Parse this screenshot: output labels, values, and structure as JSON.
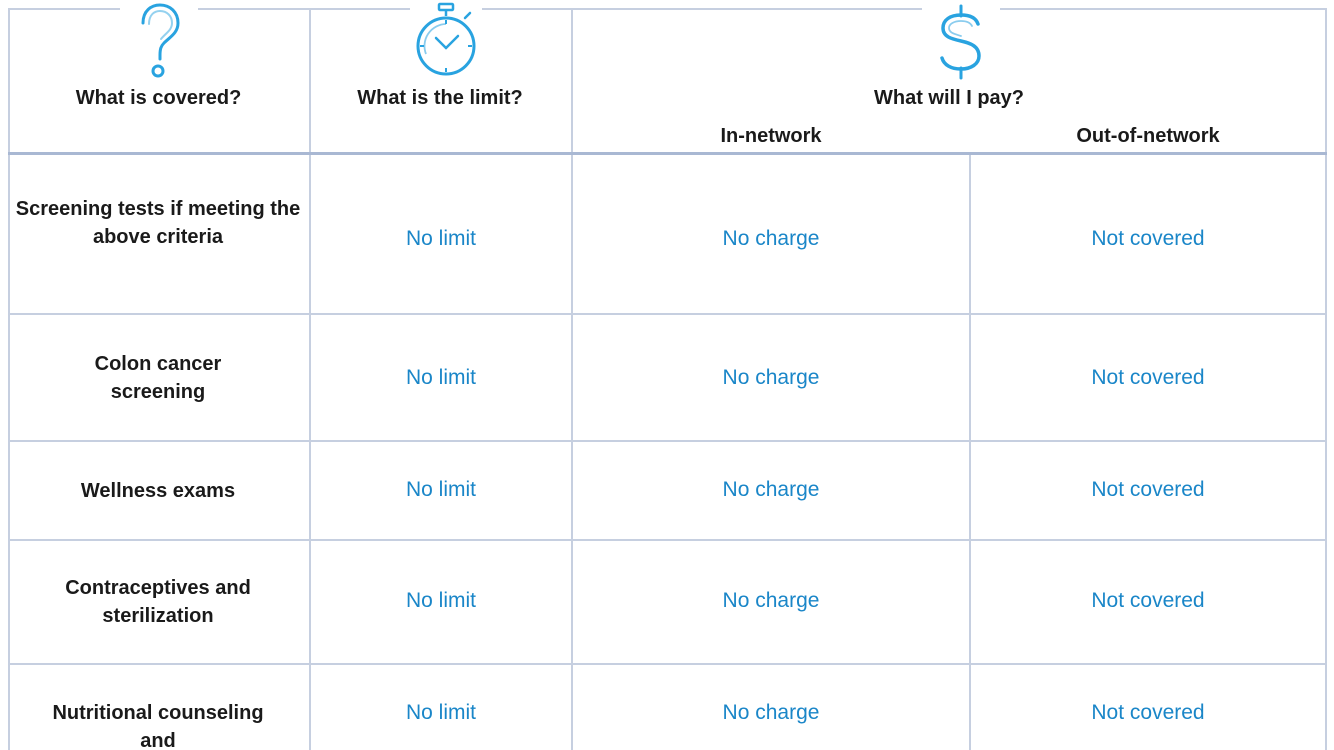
{
  "header": {
    "covered": "What is covered?",
    "limit": "What is the limit?",
    "pay": "What will I pay?",
    "in_network": "In-network",
    "out_network": "Out-of-network",
    "icons": {
      "covered": "question-mark-icon",
      "limit": "stopwatch-icon",
      "pay": "dollar-sign-icon"
    }
  },
  "colors": {
    "accent": "#29a3e0",
    "value_text": "#1a86c8",
    "grid": "#c6cfe0"
  },
  "rows": [
    {
      "service": "Screening tests if meeting the above criteria",
      "limit": "No limit",
      "in_network": "No charge",
      "out_network": "Not covered"
    },
    {
      "service": "Colon cancer screening",
      "limit": "No limit",
      "in_network": "No charge",
      "out_network": "Not covered"
    },
    {
      "service": "Wellness exams",
      "limit": "No limit",
      "in_network": "No charge",
      "out_network": "Not covered"
    },
    {
      "service": "Contraceptives and sterilization",
      "limit": "No limit",
      "in_network": "No charge",
      "out_network": "Not covered"
    },
    {
      "service": "Nutritional counseling and",
      "limit": "No limit",
      "in_network": "No charge",
      "out_network": "Not covered"
    }
  ]
}
